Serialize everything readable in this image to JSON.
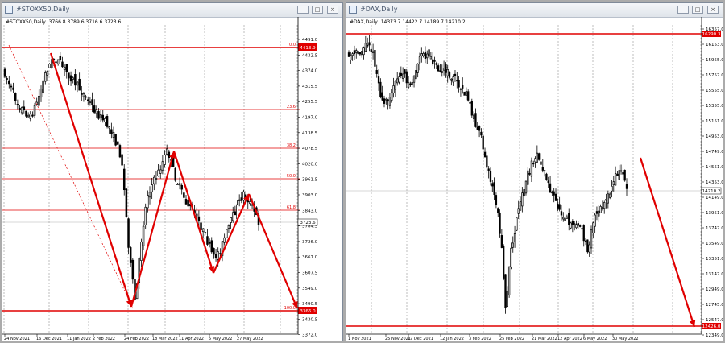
{
  "left": {
    "window_title": "#STOXX50,Daily",
    "symbol": "#STOXX50,Daily",
    "ohlc": "3766.8 3789.6 3716.6 3723.6",
    "price_ticks": [
      "4491.0",
      "4432.5",
      "4374.0",
      "4315.5",
      "4255.5",
      "4197.0",
      "4138.5",
      "4078.5",
      "4020.0",
      "3961.5",
      "3903.0",
      "3843.0",
      "3784.5",
      "3726.0",
      "3667.0",
      "3607.5",
      "3549.0",
      "3490.5",
      "3430.5",
      "3372.0",
      "3313.5"
    ],
    "date_ticks": [
      "24 Nov 2021",
      "16 Dec 2021",
      "11 Jan 2022",
      "2 Feb 2022",
      "24 Feb 2022",
      "18 Mar 2022",
      "11 Apr 2022",
      "5 May 2022",
      "27 May 2022"
    ],
    "levels": [
      {
        "pct": "0.0",
        "price": "4413.9",
        "box": true
      },
      {
        "pct": "23.6",
        "price": "",
        "box": false
      },
      {
        "pct": "38.2",
        "price": "",
        "box": false
      },
      {
        "pct": "50.0",
        "price": "",
        "box": false
      },
      {
        "pct": "61.8",
        "price": "",
        "box": false
      },
      {
        "pct": "100.0",
        "price": "3366.0",
        "box": true
      }
    ],
    "current_price": "3723.6"
  },
  "right": {
    "window_title": "#DAX,Daily",
    "symbol": "#DAX,Daily",
    "ohlc": "14373.7 14422.7 14189.7 14210.2",
    "price_ticks": [
      "16357.0",
      "16153.0",
      "15955.0",
      "15757.0",
      "15555.0",
      "15355.0",
      "15151.0",
      "14953.0",
      "14749.0",
      "14551.0",
      "14353.0",
      "14149.0",
      "13951.0",
      "13747.0",
      "13549.0",
      "13351.0",
      "13147.0",
      "12949.0",
      "12745.0",
      "12547.0",
      "12349.0"
    ],
    "date_ticks": [
      "1 Nov 2021",
      "25 Nov 2021",
      "17 Dec 2021",
      "12 Jan 2022",
      "3 Feb 2022",
      "25 Feb 2022",
      "21 Mar 2022",
      "12 Apr 2022",
      "6 May 2022",
      "30 May 2022"
    ],
    "upper_level": "16290.3",
    "current_price": "14210.2",
    "lower_level": "12426.0"
  },
  "colors": {
    "accent": "#e00000",
    "candle": "#000000",
    "grid": "#c8c8c8"
  },
  "icons": [
    "window-icon",
    "minimize-icon",
    "restore-icon",
    "close-icon"
  ]
}
